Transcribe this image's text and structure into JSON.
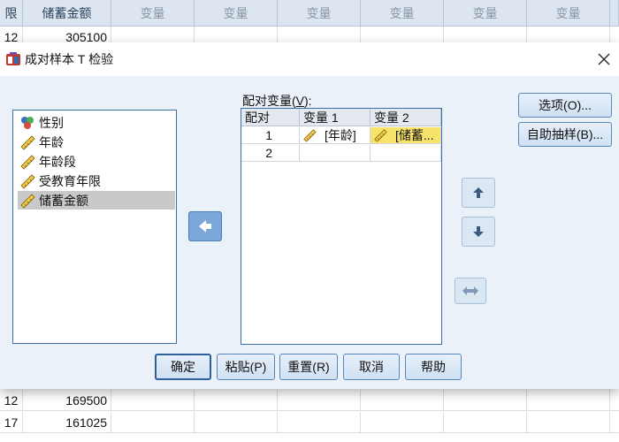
{
  "spreadsheet": {
    "columns": [
      "限",
      "储蓄金额",
      "变量",
      "变量",
      "变量",
      "变量",
      "变量",
      "变量",
      ""
    ],
    "rows_top": [
      [
        "12",
        "305100"
      ]
    ],
    "rows_bottom": [
      [
        "12",
        "169500"
      ],
      [
        "17",
        "161025"
      ]
    ]
  },
  "dialog": {
    "title": "成对样本 T 检验",
    "source_variables": [
      {
        "label": "性别",
        "icon": "nominal-variable-icon"
      },
      {
        "label": "年龄",
        "icon": "scale-variable-icon"
      },
      {
        "label": "年龄段",
        "icon": "scale-variable-icon"
      },
      {
        "label": "受教育年限",
        "icon": "scale-variable-icon"
      },
      {
        "label": "储蓄金额",
        "icon": "scale-variable-icon",
        "selected": true
      }
    ],
    "paired_variables": {
      "label_main": "配对变量(",
      "label_key": "V",
      "label_end": "):",
      "headers": [
        "配对",
        "变量 1",
        "变量 2"
      ],
      "rows": [
        {
          "num": "1",
          "var1": "[年龄]",
          "var2": "[储蓄..."
        },
        {
          "num": "2",
          "var1": "",
          "var2": ""
        }
      ]
    },
    "side_buttons": {
      "options": "选项(O)...",
      "bootstrap": "自助抽样(B)..."
    },
    "bottom_buttons": {
      "ok": "确定",
      "paste": "粘贴(P)",
      "reset": "重置(R)",
      "cancel": "取消",
      "help": "帮助"
    },
    "colors": {
      "accent": "#3c6ea8",
      "highlight": "#f7e26b",
      "selection": "#c9c9c9"
    }
  }
}
